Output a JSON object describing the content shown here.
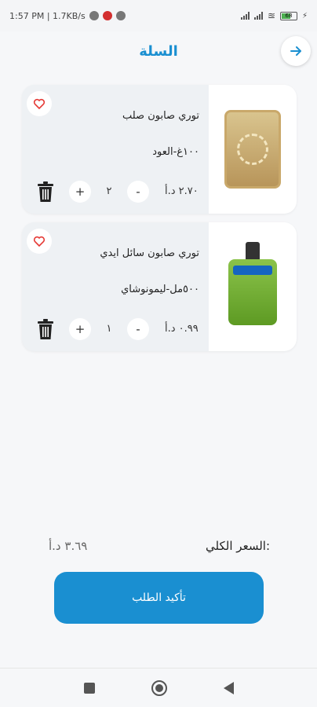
{
  "status_bar": {
    "time_speed": "1:57 PM | 1.7KB/s",
    "battery": "68"
  },
  "header": {
    "title": "السلة",
    "back_icon": "arrow-right-icon"
  },
  "cart": {
    "items": [
      {
        "name": "توري صابون صلب",
        "variant": "١٠٠غ-العود",
        "price": "٢.٧٠ د.أ",
        "quantity": "٢",
        "plus": "+",
        "minus": "-"
      },
      {
        "name": "توري صابون سائل ايدي",
        "variant": "٥٠٠مل-ليمونوشاي",
        "price": "٠.٩٩ د.أ",
        "quantity": "١",
        "plus": "+",
        "minus": "-"
      }
    ]
  },
  "total": {
    "label": "السعر الكلي:",
    "value": "٣.٦٩ د.أ"
  },
  "confirm_button": "تأكيد الطلب",
  "colors": {
    "accent": "#1a8fd1",
    "heart": "#e53935"
  }
}
